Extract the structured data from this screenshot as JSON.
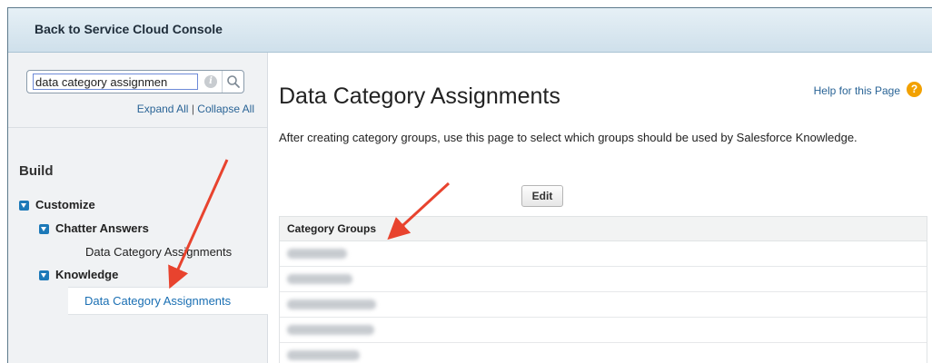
{
  "topbar": {
    "back_link": "Back to Service Cloud Console"
  },
  "sidebar": {
    "search_value": "data category assignmen",
    "expand_all": "Expand All",
    "separator": "|",
    "collapse_all": "Collapse All",
    "section": "Build",
    "tree": {
      "customize": "Customize",
      "chatter_answers": "Chatter Answers",
      "chatter_item": "Data Category Assignments",
      "knowledge": "Knowledge",
      "knowledge_item": "Data Category Assignments"
    }
  },
  "main": {
    "title": "Data Category Assignments",
    "help_link": "Help for this Page",
    "help_icon": "?",
    "description": "After creating category groups, use this page to select which groups should be used by Salesforce Knowledge.",
    "edit_button": "Edit",
    "table": {
      "header": "Category Groups",
      "row_count": 5
    }
  },
  "colors": {
    "link": "#2a6496",
    "accent": "#1c79b8",
    "annotation_arrow": "#e8432e"
  }
}
